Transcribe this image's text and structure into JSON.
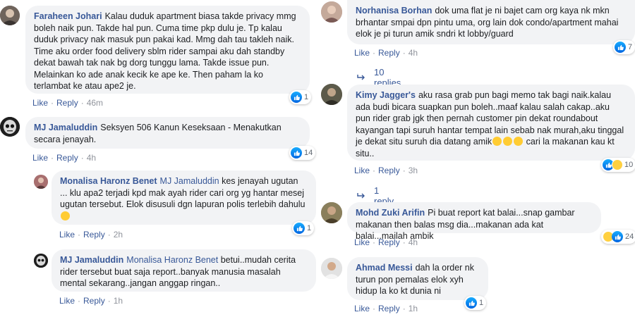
{
  "left": {
    "c1": {
      "name": "Faraheen Johari",
      "text": "Kalau duduk apartment biasa takde privacy mmg boleh naik pun. Takde hal pun. Cuma time pkp dulu je. Tp kalau duduk privacy nak masuk pun pakai kad. Mmg dah tau takleh naik. Time aku order food delivery sblm rider sampai aku dah standby dekat bawah tak nak bg dorg tunggu lama. Takde issue pun. Melainkan ko ade anak kecik ke ape ke. Then paham la ko terlambat ke atau ape2 je.",
      "like": "Like",
      "reply": "Reply",
      "time": "46m",
      "reactions": "1"
    },
    "c2": {
      "name": "MJ Jamaluddin",
      "text": "Seksyen 506 Kanun Keseksaan - Menakutkan secara jenayah.",
      "like": "Like",
      "reply": "Reply",
      "time": "4h",
      "reactions": "14"
    },
    "c3": {
      "name": "Monalisa Haronz Benet",
      "tag": "MJ Jamaluddin",
      "text": "kes jenayah ugutan ... klu apa2 terjadi kpd mak ayah rider cari org yg hantar mesej ugutan tersebut. Elok disusuli dgn lapuran polis terlebih dahulu",
      "like": "Like",
      "reply": "Reply",
      "time": "2h",
      "reactions": "1"
    },
    "c4": {
      "name": "MJ Jamaluddin",
      "tag": "Monalisa Haronz Benet",
      "text": "betui..mudah cerita rider tersebut buat saja report..banyak manusia masalah mental sekarang..jangan anggap ringan..",
      "like": "Like",
      "reply": "Reply",
      "time": "1h",
      "reactions": "1"
    }
  },
  "right": {
    "c1": {
      "name": "Norhanisa Borhan",
      "text": "dok uma flat je ni bajet cam org kaya nk mkn brhantar smpai dpn pintu uma, org lain dok condo/apartment mahai elok je pi turun amik sndri kt lobby/guard",
      "like": "Like",
      "reply": "Reply",
      "time": "4h",
      "reactions": "7",
      "replies": "10 replies"
    },
    "c2": {
      "name": "Kimy Jagger's",
      "text": "aku rasa grab pun bagi memo tak bagi naik.kalau ada budi bicara suapkan pun boleh..maaf kalau salah cakap..aku pun rider grab jgk then pernah customer pin dekat roundabout kayangan tapi suruh hantar tempat lain sebab nak murah,aku tinggal je dekat situ suruh dia datang amik",
      "text_end": "cari la makanan kau kt situ..",
      "like": "Like",
      "reply": "Reply",
      "time": "3h",
      "reactions": "10",
      "replies": "1 reply"
    },
    "c3": {
      "name": "Mohd Zuki Arifin",
      "text": "Pi buat report kat balai...snap gambar makanan then balas msg dia...makanan ada kat balai...mailah ambik",
      "like": "Like",
      "reply": "Reply",
      "time": "4h",
      "reactions": "24"
    },
    "c4": {
      "name": "Ahmad Messi",
      "text": "dah la order nk turun pon pemalas elok xyh hidup la ko kt dunia ni",
      "like": "Like",
      "reply": "Reply",
      "time": "1h",
      "reactions": "1"
    }
  },
  "colors": {
    "link": "#385898",
    "bubble": "#f2f3f5",
    "meta": "#90949c",
    "like_blue": "#1877f2"
  }
}
